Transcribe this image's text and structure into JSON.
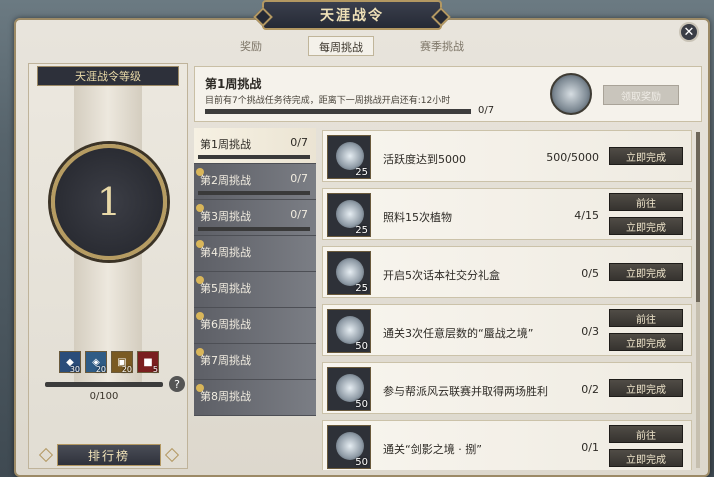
{
  "window": {
    "title": "天涯战令"
  },
  "tabs": [
    {
      "label": "奖励"
    },
    {
      "label": "每周挑战",
      "active": true
    },
    {
      "label": "赛季挑战"
    }
  ],
  "level_panel": {
    "title": "天涯战令等级",
    "level": "1",
    "rewards": [
      {
        "icon": "blue-crystal-icon",
        "count": "30"
      },
      {
        "icon": "blue-gem-icon",
        "count": "20"
      },
      {
        "icon": "gold-item-icon",
        "count": "20"
      },
      {
        "icon": "red-chest-icon",
        "count": "5"
      }
    ],
    "progress_text": "0/100",
    "rank_button": "排行榜"
  },
  "week_header": {
    "title": "第1周挑战",
    "subtitle": "目前有7个挑战任务待完成，距离下一周挑战开启还有:12小时",
    "count": "0/7",
    "claim_button": "领取奖励"
  },
  "weeks": [
    {
      "label": "第1周挑战",
      "count": "0/7",
      "active": true,
      "has_bar": true
    },
    {
      "label": "第2周挑战",
      "count": "0/7",
      "has_bar": true
    },
    {
      "label": "第3周挑战",
      "count": "0/7",
      "has_bar": true
    },
    {
      "label": "第4周挑战",
      "count": ""
    },
    {
      "label": "第5周挑战",
      "count": ""
    },
    {
      "label": "第6周挑战",
      "count": ""
    },
    {
      "label": "第7周挑战",
      "count": ""
    },
    {
      "label": "第8周挑战",
      "count": ""
    }
  ],
  "tasks": [
    {
      "reward": "25",
      "name": "活跃度达到5000",
      "progress": "500/5000",
      "buttons": [
        "立即完成"
      ]
    },
    {
      "reward": "25",
      "name": "照料15次植物",
      "progress": "4/15",
      "buttons": [
        "前往",
        "立即完成"
      ]
    },
    {
      "reward": "25",
      "name": "开启5次话本社交分礼盒",
      "progress": "0/5",
      "buttons": [
        "立即完成"
      ]
    },
    {
      "reward": "50",
      "name": "通关3次任意层数的“蜃战之境”",
      "progress": "0/3",
      "buttons": [
        "前往",
        "立即完成"
      ]
    },
    {
      "reward": "50",
      "name": "参与帮派风云联赛并取得两场胜利",
      "progress": "0/2",
      "buttons": [
        "立即完成"
      ]
    },
    {
      "reward": "50",
      "name": "通关“剑影之境 · 捌”",
      "progress": "0/1",
      "buttons": [
        "前往",
        "立即完成"
      ]
    }
  ]
}
